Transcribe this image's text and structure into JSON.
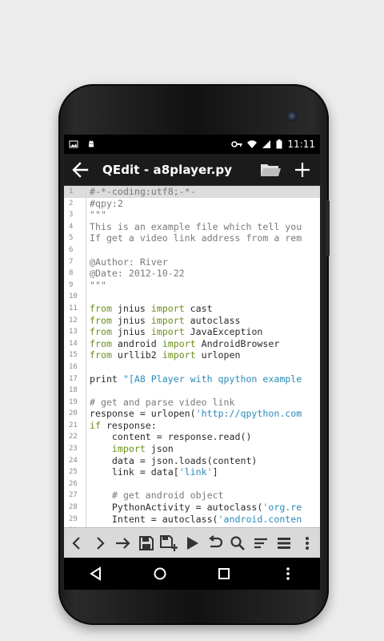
{
  "device": {
    "status_time": "11:11"
  },
  "actionbar": {
    "title": "QEdit - a8player.py",
    "icons": [
      "back-arrow-icon",
      "folder-icon",
      "add-icon"
    ]
  },
  "editor": {
    "lines": [
      [
        {
          "t": "#-*-coding:utf8;-*-",
          "c": "cmt"
        }
      ],
      [
        {
          "t": "#qpy:2",
          "c": "cmt"
        }
      ],
      [
        {
          "t": "\"\"\"",
          "c": "cmt"
        }
      ],
      [
        {
          "t": "This is an example file which tell you",
          "c": "cmt"
        }
      ],
      [
        {
          "t": "If get a video link address from a rem",
          "c": "cmt"
        }
      ],
      [
        {
          "t": "",
          "c": ""
        }
      ],
      [
        {
          "t": "@Author: River",
          "c": "cmt"
        }
      ],
      [
        {
          "t": "@Date: 2012-10-22",
          "c": "cmt"
        }
      ],
      [
        {
          "t": "\"\"\"",
          "c": "cmt"
        }
      ],
      [
        {
          "t": "",
          "c": ""
        }
      ],
      [
        {
          "t": "from",
          "c": "kw"
        },
        {
          "t": " jnius ",
          "c": ""
        },
        {
          "t": "import",
          "c": "kw"
        },
        {
          "t": " cast",
          "c": ""
        }
      ],
      [
        {
          "t": "from",
          "c": "kw"
        },
        {
          "t": " jnius ",
          "c": ""
        },
        {
          "t": "import",
          "c": "kw"
        },
        {
          "t": " autoclass",
          "c": ""
        }
      ],
      [
        {
          "t": "from",
          "c": "kw"
        },
        {
          "t": " jnius ",
          "c": ""
        },
        {
          "t": "import",
          "c": "kw"
        },
        {
          "t": " JavaException",
          "c": ""
        }
      ],
      [
        {
          "t": "from",
          "c": "kw"
        },
        {
          "t": " android ",
          "c": ""
        },
        {
          "t": "import",
          "c": "kw"
        },
        {
          "t": " AndroidBrowser",
          "c": ""
        }
      ],
      [
        {
          "t": "from",
          "c": "kw"
        },
        {
          "t": " urllib2 ",
          "c": ""
        },
        {
          "t": "import",
          "c": "kw"
        },
        {
          "t": " urlopen",
          "c": ""
        }
      ],
      [
        {
          "t": "",
          "c": ""
        }
      ],
      [
        {
          "t": "print ",
          "c": ""
        },
        {
          "t": "\"[A8 Player with qpython example",
          "c": "str"
        }
      ],
      [
        {
          "t": "",
          "c": ""
        }
      ],
      [
        {
          "t": "# get and parse video link",
          "c": "cmt"
        }
      ],
      [
        {
          "t": "response = urlopen(",
          "c": ""
        },
        {
          "t": "'http://qpython.com",
          "c": "str"
        }
      ],
      [
        {
          "t": "if",
          "c": "kw"
        },
        {
          "t": " response:",
          "c": ""
        }
      ],
      [
        {
          "t": "    content = response.read()",
          "c": ""
        }
      ],
      [
        {
          "t": "    ",
          "c": ""
        },
        {
          "t": "import",
          "c": "kw"
        },
        {
          "t": " json",
          "c": ""
        }
      ],
      [
        {
          "t": "    data = json.loads(content)",
          "c": ""
        }
      ],
      [
        {
          "t": "    link = data[",
          "c": ""
        },
        {
          "t": "'link'",
          "c": "str"
        },
        {
          "t": "]",
          "c": ""
        }
      ],
      [
        {
          "t": "",
          "c": ""
        }
      ],
      [
        {
          "t": "    # get android object",
          "c": "cmt"
        }
      ],
      [
        {
          "t": "    PythonActivity = autoclass(",
          "c": ""
        },
        {
          "t": "'org.re",
          "c": "str"
        }
      ],
      [
        {
          "t": "    Intent = autoclass(",
          "c": ""
        },
        {
          "t": "'android.conten",
          "c": "str"
        }
      ],
      [
        {
          "t": "",
          "c": ""
        }
      ]
    ]
  },
  "toolbar": {
    "icons": [
      "undo-nav-left-icon",
      "nav-right-icon",
      "goto-arrow-icon",
      "save-icon",
      "save-as-icon",
      "run-icon",
      "undo-icon",
      "search-icon",
      "format-icon",
      "list-icon",
      "overflow-menu-icon"
    ]
  },
  "navbar": {
    "icons": [
      "nav-back-icon",
      "nav-home-icon",
      "nav-recents-icon",
      "nav-menu-icon"
    ]
  },
  "colors": {
    "keyword": "#6a8f1a",
    "string": "#2a8ab8",
    "comment": "#7a7a7a",
    "line_highlight": "#dcdcdc"
  }
}
